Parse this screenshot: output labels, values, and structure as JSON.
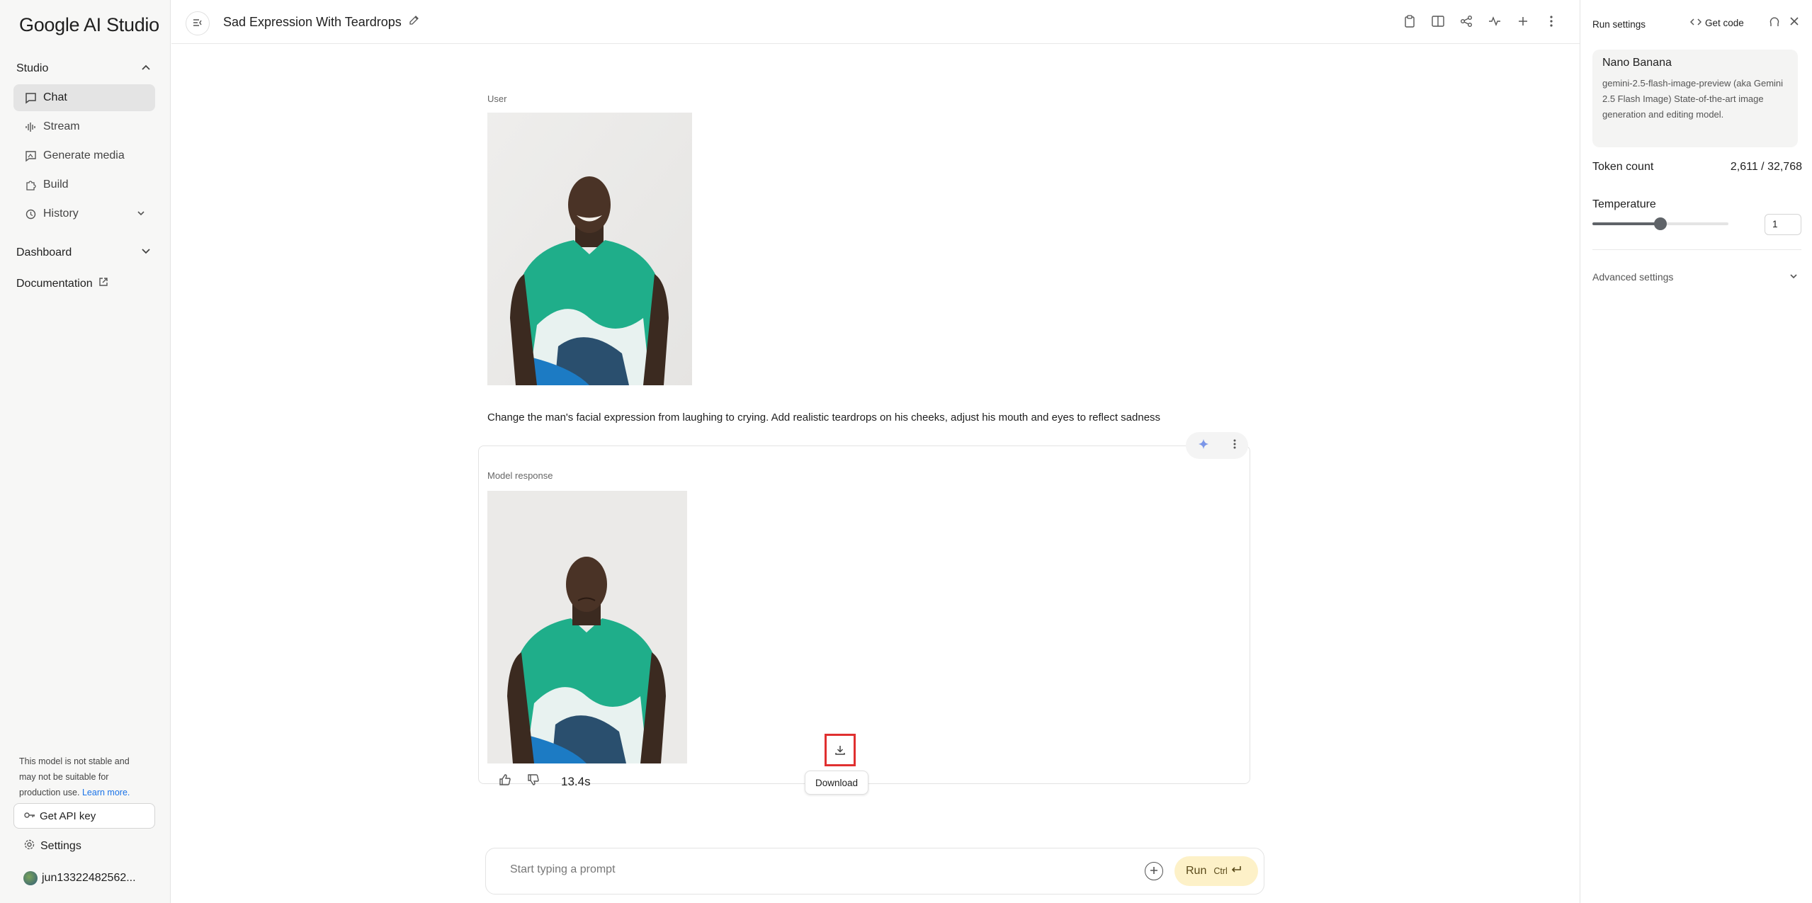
{
  "sidebar": {
    "logo": "Google AI Studio",
    "studio_label": "Studio",
    "items": [
      {
        "label": "Chat",
        "icon": "chat-icon"
      },
      {
        "label": "Stream",
        "icon": "waveform-icon"
      },
      {
        "label": "Generate media",
        "icon": "media-icon"
      },
      {
        "label": "Build",
        "icon": "puzzle-icon"
      },
      {
        "label": "History",
        "icon": "history-icon"
      }
    ],
    "dashboard_label": "Dashboard",
    "documentation_label": "Documentation",
    "note": "This model is not stable and may not be suitable for production use.",
    "note_link": "Learn more.",
    "api_key_label": "Get API key",
    "settings_label": "Settings",
    "user_label": "jun13322482562..."
  },
  "header": {
    "title": "Sad Expression With Teardrops"
  },
  "chat": {
    "user_role": "User",
    "prompt": "Change the man's facial expression from laughing to crying. Add realistic teardrops on his cheeks, adjust his mouth and eyes to reflect sadness",
    "model_role": "Model response",
    "response_time": "13.4s",
    "tooltip": "Download"
  },
  "input": {
    "placeholder": "Start typing a prompt",
    "run_label": "Run",
    "run_shortcut": "Ctrl"
  },
  "run_settings": {
    "title": "Run settings",
    "get_code": "Get code",
    "model_name": "Nano Banana",
    "model_desc": "gemini-2.5-flash-image-preview (aka Gemini 2.5 Flash Image) State-of-the-art image generation and editing model.",
    "token_label": "Token count",
    "token_value": "2,611 / 32,768",
    "temperature_label": "Temperature",
    "temperature_value": "1",
    "temperature_fraction": 0.5,
    "advanced_label": "Advanced settings"
  },
  "colors": {
    "run_button_bg": "#fdf1c8",
    "highlight": "#e03030",
    "link": "#1a73e8"
  }
}
